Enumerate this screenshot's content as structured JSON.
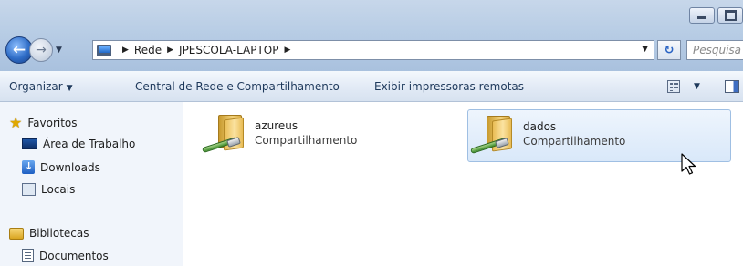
{
  "address_bar": {
    "crumbs": [
      "Rede",
      "JPESCOLA-LAPTOP"
    ],
    "search_placeholder": "Pesquisa"
  },
  "commands": {
    "organize": "Organizar",
    "network_center": "Central de Rede e Compartilhamento",
    "remote_printers": "Exibir impressoras remotas"
  },
  "sidebar": {
    "favorites_header": "Favoritos",
    "favorites": [
      "Área de Trabalho",
      "Downloads",
      "Locais"
    ],
    "libraries_header": "Bibliotecas",
    "libraries": [
      "Documentos"
    ]
  },
  "shares": [
    {
      "name": "azureus",
      "type": "Compartilhamento",
      "selected": false
    },
    {
      "name": "dados",
      "type": "Compartilhamento",
      "selected": true
    }
  ],
  "icons": {
    "back": "back-arrow-icon",
    "forward": "forward-arrow-icon",
    "refresh": "refresh-icon",
    "views": "views-icon",
    "preview_pane": "preview-pane-icon"
  },
  "colors": {
    "chrome": "#b8cde5",
    "command_text": "#1e395b",
    "selection_border": "#9fbfe3"
  }
}
